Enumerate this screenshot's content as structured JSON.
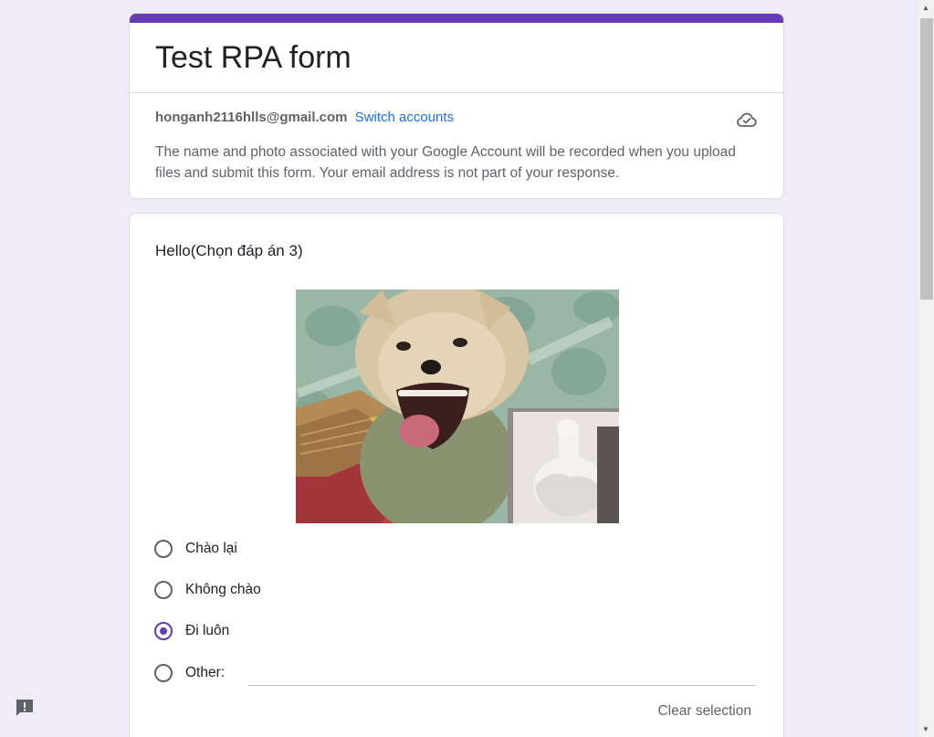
{
  "colors": {
    "accent": "#673ab7",
    "link": "#1a73e8",
    "background": "#f0ebf8"
  },
  "form": {
    "title": "Test RPA form"
  },
  "account": {
    "email": "honganh2116hlls@gmail.com",
    "switch_label": "Switch accounts",
    "cloud_icon": "cloud-done-icon",
    "note": "The name and photo associated with your Google Account will be recorded when you upload files and submit this form. Your email address is not part of your response."
  },
  "question": {
    "title": "Hello(Chọn đáp án 3)",
    "options": [
      {
        "label": "Chào lại",
        "checked": false
      },
      {
        "label": "Không chào",
        "checked": false
      },
      {
        "label": "Đi luôn",
        "checked": true
      },
      {
        "label": "Other:",
        "checked": false
      }
    ],
    "other_value": "",
    "clear_label": "Clear selection"
  },
  "report_icon": "report-icon"
}
